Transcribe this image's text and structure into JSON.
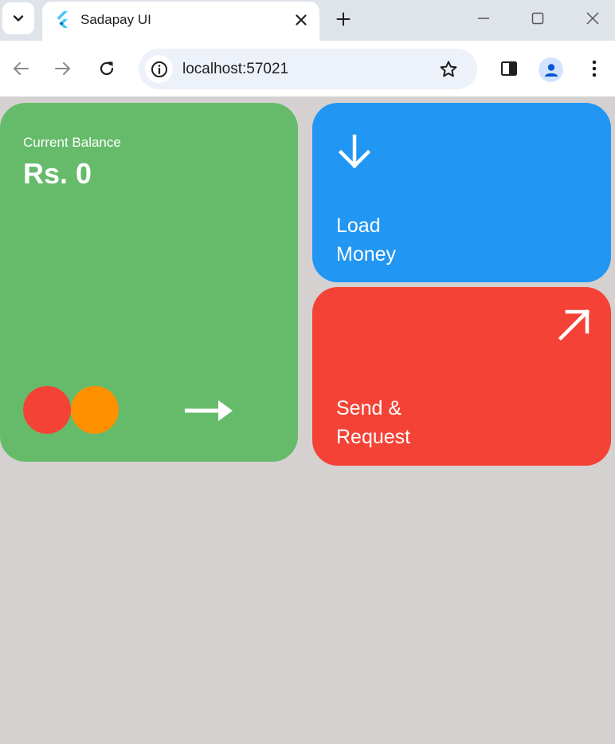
{
  "browser": {
    "tab_title": "Sadapay UI",
    "url": "localhost:57021"
  },
  "colors": {
    "balance_card": "#66bb6a",
    "load_card": "#2196f3",
    "send_card": "#f44336",
    "circle_red": "#f44336",
    "circle_orange": "#ff9100",
    "background": "#d6d1d1"
  },
  "balance": {
    "label": "Current Balance",
    "value": "Rs. 0"
  },
  "load_money": {
    "line1": "Load",
    "line2": "Money",
    "icon": "arrow-down-icon"
  },
  "send_request": {
    "line1": "Send &",
    "line2": "Request",
    "icon": "arrow-up-right-icon"
  }
}
